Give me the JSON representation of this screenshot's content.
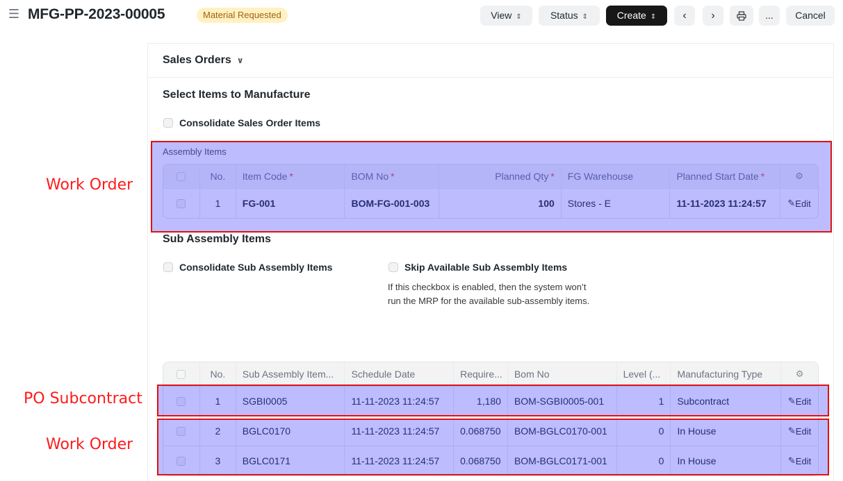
{
  "header": {
    "menu_icon": "hamburger-icon",
    "title": "MFG-PP-2023-00005",
    "status": "Material Requested",
    "buttons": {
      "view": "View",
      "status": "Status",
      "create": "Create",
      "cancel": "Cancel",
      "more": "..."
    },
    "icons": {
      "prev": "chevron-left-icon",
      "next": "chevron-right-icon",
      "print": "printer-icon",
      "dropdown": "chevron-updown-icon"
    }
  },
  "sales_orders": {
    "title": "Sales Orders",
    "toggle_icon": "chevron-down-icon"
  },
  "select_items": {
    "title": "Select Items to Manufacture",
    "consolidate_label": "Consolidate Sales Order Items",
    "consolidate_checked": false
  },
  "assembly_items": {
    "label": "Assembly Items",
    "columns": [
      "No.",
      "Item Code",
      "BOM No",
      "Planned Qty",
      "FG Warehouse",
      "Planned Start Date"
    ],
    "required_mark": "*",
    "settings_icon": "gear-icon",
    "rows": [
      {
        "no": "1",
        "item_code": "FG-001",
        "bom_no": "BOM-FG-001-003",
        "planned_qty": "100",
        "fg_warehouse": "Stores - E",
        "planned_start_date": "11-11-2023 11:24:57",
        "edit": "Edit"
      }
    ]
  },
  "sub_assembly": {
    "title": "Sub Assembly Items",
    "consolidate_label": "Consolidate Sub Assembly Items",
    "skip_label": "Skip Available Sub Assembly Items",
    "skip_help": "If this checkbox is enabled, then the system won’t run the MRP for the available sub-assembly items.",
    "columns": [
      "No.",
      "Sub Assembly Item...",
      "Schedule Date",
      "Require...",
      "Bom No",
      "Level (...",
      "Manufacturing Type"
    ],
    "settings_icon": "gear-icon",
    "rows": [
      {
        "no": "1",
        "item": "SGBI0005",
        "schedule_date": "11-11-2023 11:24:57",
        "required": "1,180",
        "bom_no": "BOM-SGBI0005-001",
        "level": "1",
        "type": "Subcontract",
        "edit": "Edit"
      },
      {
        "no": "2",
        "item": "BGLC0170",
        "schedule_date": "11-11-2023 11:24:57",
        "required": "0.068750",
        "bom_no": "BOM-BGLC0170-001",
        "level": "0",
        "type": "In House",
        "edit": "Edit"
      },
      {
        "no": "3",
        "item": "BGLC0171",
        "schedule_date": "11-11-2023 11:24:57",
        "required": "0.068750",
        "bom_no": "BOM-BGLC0171-001",
        "level": "0",
        "type": "In House",
        "edit": "Edit"
      }
    ]
  },
  "annotations": {
    "work_order_1": "Work Order",
    "po_subcontract": "PO Subcontract",
    "work_order_2": "Work Order",
    "highlight_color": "#e01010"
  }
}
